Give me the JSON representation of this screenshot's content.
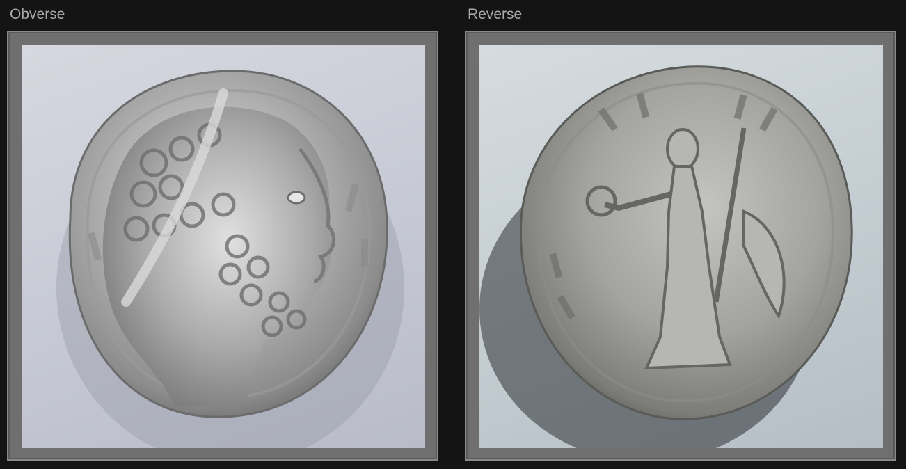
{
  "panels": [
    {
      "label": "Obverse"
    },
    {
      "label": "Reverse"
    }
  ],
  "colors": {
    "background": "#141414",
    "frame": "#6f6f6f",
    "label": "#a9a9a9",
    "silver": "#b8b8b8"
  },
  "icons": {
    "obverse_image": "coin-obverse-laureate-head",
    "reverse_image": "coin-reverse-victory-figure"
  }
}
